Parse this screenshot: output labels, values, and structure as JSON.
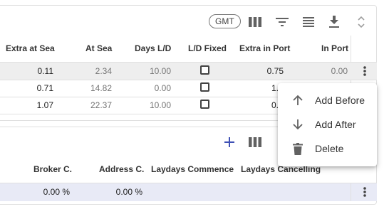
{
  "toolbar_top": {
    "timezone_chip": "GMT",
    "icons": [
      "columns-icon",
      "filter-icon",
      "density-icon",
      "download-icon",
      "sort-icon"
    ]
  },
  "top_table": {
    "headers": {
      "extra_at_sea": "Extra at Sea",
      "at_sea": "At Sea",
      "days_ld": "Days L/D",
      "ld_fixed": "L/D Fixed",
      "extra_in_port": "Extra in Port",
      "in_port": "In Port"
    },
    "rows": [
      {
        "extra_at_sea": "0.11",
        "at_sea": "2.34",
        "days_ld": "10.00",
        "ld_fixed": false,
        "extra_in_port": "0.75",
        "in_port": "0.00"
      },
      {
        "extra_at_sea": "0.71",
        "at_sea": "14.82",
        "days_ld": "0.00",
        "ld_fixed": false,
        "extra_in_port": "1."
      },
      {
        "extra_at_sea": "1.07",
        "at_sea": "22.37",
        "days_ld": "10.00",
        "ld_fixed": false,
        "extra_in_port": "0."
      }
    ]
  },
  "context_menu": {
    "items": [
      {
        "label": "Add Before",
        "icon": "arrow-up-icon"
      },
      {
        "label": "Add After",
        "icon": "arrow-down-icon"
      },
      {
        "label": "Delete",
        "icon": "trash-icon"
      }
    ]
  },
  "bottom_table": {
    "headers": {
      "broker_c": "Broker C.",
      "address_c": "Address C.",
      "laydays_commence": "Laydays Commence",
      "laydays_cancelling": "Laydays Cancelling"
    },
    "rows": [
      {
        "broker_c": "0.00 %",
        "address_c": "0.00 %"
      }
    ]
  },
  "colors": {
    "accent": "#3f51b5",
    "selected_row": "#eeeeee",
    "selected_row_bottom": "#e8eaf6",
    "icon": "#616161"
  }
}
